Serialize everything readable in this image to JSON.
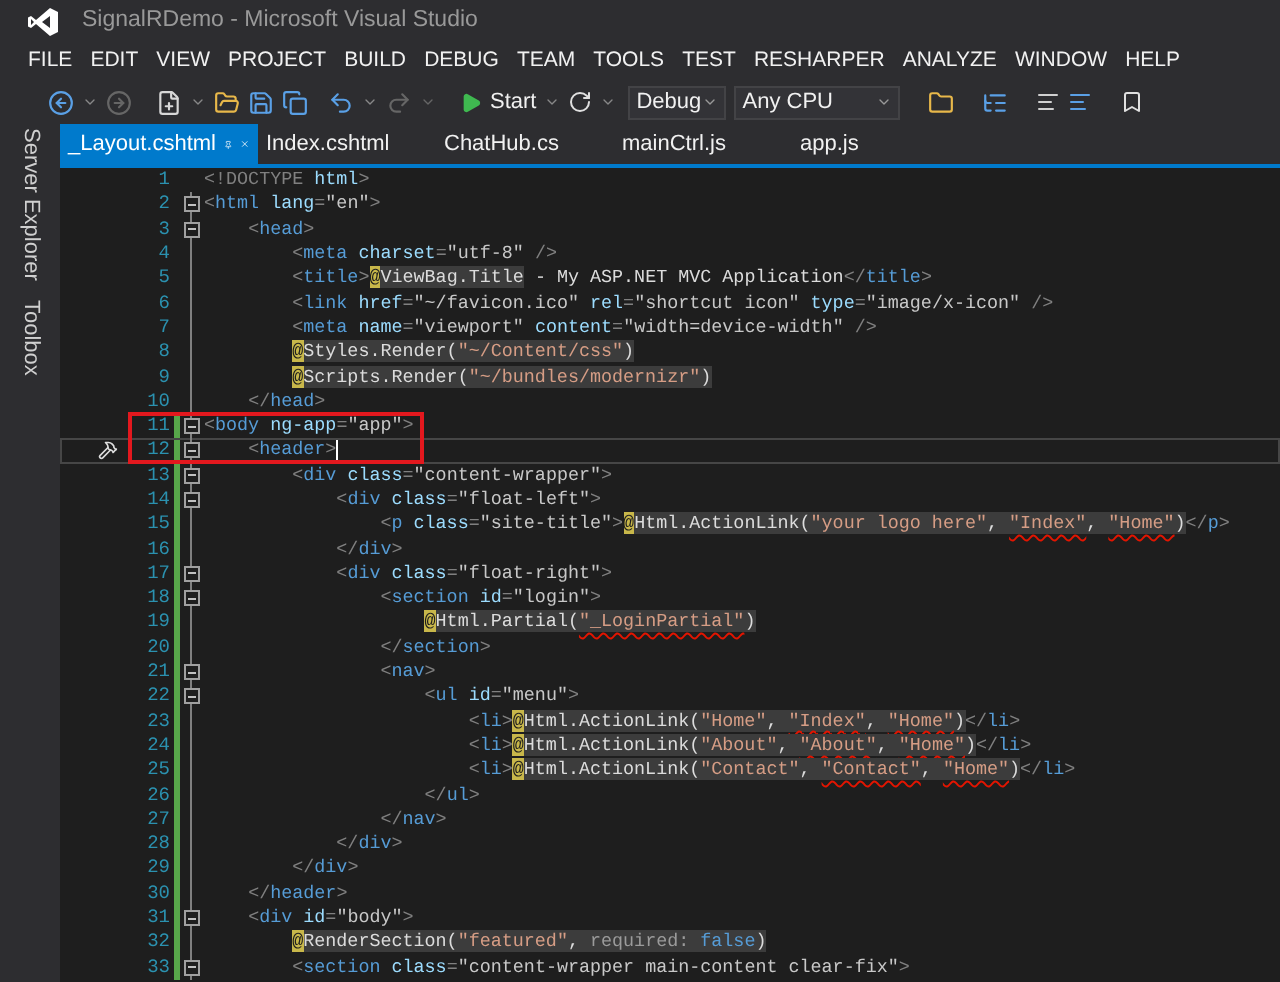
{
  "window": {
    "title": "SignalRDemo - Microsoft Visual Studio"
  },
  "menu": [
    "FILE",
    "EDIT",
    "VIEW",
    "PROJECT",
    "BUILD",
    "DEBUG",
    "TEAM",
    "TOOLS",
    "TEST",
    "RESHARPER",
    "ANALYZE",
    "WINDOW",
    "HELP"
  ],
  "toolbar": {
    "start": "Start",
    "configuration": "Debug",
    "platform": "Any CPU"
  },
  "side_tabs": [
    "Server Explorer",
    "Toolbox"
  ],
  "tabs": [
    {
      "label": "_Layout.cshtml",
      "selected": true
    },
    {
      "label": "Index.cshtml",
      "selected": false
    },
    {
      "label": "ChatHub.cs",
      "selected": false
    },
    {
      "label": "mainCtrl.js",
      "selected": false
    },
    {
      "label": "app.js",
      "selected": false
    }
  ],
  "editor": {
    "lines": [
      {
        "number": "1",
        "foldable": false,
        "changed": false,
        "current": false,
        "segments": [
          {
            "kind": "punct",
            "text": "<!DOCTYPE"
          },
          {
            "kind": "attr",
            "text": " html"
          },
          {
            "kind": "punct",
            "text": ">"
          }
        ]
      },
      {
        "number": "2",
        "foldable": true,
        "changed": false,
        "current": false,
        "segments": [
          {
            "kind": "punct",
            "text": "<"
          },
          {
            "kind": "tag",
            "text": "html"
          },
          {
            "kind": "attr",
            "text": " lang"
          },
          {
            "kind": "punct",
            "text": "="
          },
          {
            "kind": "value",
            "text": "\"en\""
          },
          {
            "kind": "punct",
            "text": ">"
          }
        ]
      },
      {
        "number": "3",
        "foldable": true,
        "changed": false,
        "current": false,
        "segments": [
          {
            "kind": "punct",
            "text": "    <"
          },
          {
            "kind": "tag",
            "text": "head"
          },
          {
            "kind": "punct",
            "text": ">"
          }
        ]
      },
      {
        "number": "4",
        "foldable": false,
        "changed": false,
        "current": false,
        "segments": [
          {
            "kind": "punct",
            "text": "        <"
          },
          {
            "kind": "tag",
            "text": "meta"
          },
          {
            "kind": "attr",
            "text": " charset"
          },
          {
            "kind": "punct",
            "text": "="
          },
          {
            "kind": "value",
            "text": "\"utf-8\""
          },
          {
            "kind": "punct",
            "text": " />"
          }
        ]
      },
      {
        "number": "5",
        "foldable": false,
        "changed": false,
        "current": false,
        "segments": [
          {
            "kind": "punct",
            "text": "        <"
          },
          {
            "kind": "tag",
            "text": "title"
          },
          {
            "kind": "punct",
            "text": ">"
          },
          {
            "kind": "at",
            "text": "@"
          },
          {
            "kind": "code",
            "text": "ViewBag.Title"
          },
          {
            "kind": "text",
            "text": " - My ASP.NET MVC Application"
          },
          {
            "kind": "punct",
            "text": "</"
          },
          {
            "kind": "tag",
            "text": "title"
          },
          {
            "kind": "punct",
            "text": ">"
          }
        ]
      },
      {
        "number": "6",
        "foldable": false,
        "changed": false,
        "current": false,
        "segments": [
          {
            "kind": "punct",
            "text": "        <"
          },
          {
            "kind": "tag",
            "text": "link"
          },
          {
            "kind": "attr",
            "text": " href"
          },
          {
            "kind": "punct",
            "text": "="
          },
          {
            "kind": "value",
            "text": "\"~/favicon.ico\""
          },
          {
            "kind": "attr",
            "text": " rel"
          },
          {
            "kind": "punct",
            "text": "="
          },
          {
            "kind": "value",
            "text": "\"shortcut icon\""
          },
          {
            "kind": "attr",
            "text": " type"
          },
          {
            "kind": "punct",
            "text": "="
          },
          {
            "kind": "value",
            "text": "\"image/x-icon\""
          },
          {
            "kind": "punct",
            "text": " />"
          }
        ]
      },
      {
        "number": "7",
        "foldable": false,
        "changed": false,
        "current": false,
        "segments": [
          {
            "kind": "punct",
            "text": "        <"
          },
          {
            "kind": "tag",
            "text": "meta"
          },
          {
            "kind": "attr",
            "text": " name"
          },
          {
            "kind": "punct",
            "text": "="
          },
          {
            "kind": "value",
            "text": "\"viewport\""
          },
          {
            "kind": "attr",
            "text": " content"
          },
          {
            "kind": "punct",
            "text": "="
          },
          {
            "kind": "value",
            "text": "\"width=device-width\""
          },
          {
            "kind": "punct",
            "text": " />"
          }
        ]
      },
      {
        "number": "8",
        "foldable": false,
        "changed": false,
        "current": false,
        "segments": [
          {
            "kind": "at",
            "text": "        @"
          },
          {
            "kind": "code",
            "text": "Styles.Render("
          },
          {
            "kind": "string",
            "text": "\"~/Content/css\""
          },
          {
            "kind": "code",
            "text": ")"
          }
        ]
      },
      {
        "number": "9",
        "foldable": false,
        "changed": false,
        "current": false,
        "segments": [
          {
            "kind": "at",
            "text": "        @"
          },
          {
            "kind": "code",
            "text": "Scripts.Render("
          },
          {
            "kind": "string",
            "text": "\"~/bundles/modernizr\""
          },
          {
            "kind": "code",
            "text": ")"
          }
        ]
      },
      {
        "number": "10",
        "foldable": false,
        "changed": false,
        "current": false,
        "segments": [
          {
            "kind": "punct",
            "text": "    </"
          },
          {
            "kind": "tag",
            "text": "head"
          },
          {
            "kind": "punct",
            "text": ">"
          }
        ]
      },
      {
        "number": "11",
        "foldable": true,
        "changed": true,
        "current": false,
        "segments": [
          {
            "kind": "punct",
            "text": "<"
          },
          {
            "kind": "tag",
            "text": "body"
          },
          {
            "kind": "attr",
            "text": " ng-app"
          },
          {
            "kind": "punct",
            "text": "="
          },
          {
            "kind": "value",
            "text": "\"app\""
          },
          {
            "kind": "punct",
            "text": ">"
          }
        ]
      },
      {
        "number": "12",
        "foldable": true,
        "changed": true,
        "current": true,
        "segments": [
          {
            "kind": "punct",
            "text": "    <"
          },
          {
            "kind": "tag",
            "text": "header"
          },
          {
            "kind": "punct",
            "text": ">"
          }
        ]
      },
      {
        "number": "13",
        "foldable": true,
        "changed": true,
        "current": false,
        "segments": [
          {
            "kind": "punct",
            "text": "        <"
          },
          {
            "kind": "tag",
            "text": "div"
          },
          {
            "kind": "attr",
            "text": " class"
          },
          {
            "kind": "punct",
            "text": "="
          },
          {
            "kind": "value",
            "text": "\"content-wrapper\""
          },
          {
            "kind": "punct",
            "text": ">"
          }
        ]
      },
      {
        "number": "14",
        "foldable": true,
        "changed": true,
        "current": false,
        "segments": [
          {
            "kind": "punct",
            "text": "            <"
          },
          {
            "kind": "tag",
            "text": "div"
          },
          {
            "kind": "attr",
            "text": " class"
          },
          {
            "kind": "punct",
            "text": "="
          },
          {
            "kind": "value",
            "text": "\"float-left\""
          },
          {
            "kind": "punct",
            "text": ">"
          }
        ]
      },
      {
        "number": "15",
        "foldable": false,
        "changed": true,
        "current": false,
        "segments": [
          {
            "kind": "punct",
            "text": "                <"
          },
          {
            "kind": "tag",
            "text": "p"
          },
          {
            "kind": "attr",
            "text": " class"
          },
          {
            "kind": "punct",
            "text": "="
          },
          {
            "kind": "value",
            "text": "\"site-title\""
          },
          {
            "kind": "punct",
            "text": ">"
          },
          {
            "kind": "at",
            "text": "@"
          },
          {
            "kind": "code",
            "text": "Html.ActionLink("
          },
          {
            "kind": "string",
            "text": "\"your logo here\""
          },
          {
            "kind": "code",
            "text": ", "
          },
          {
            "kind": "flagged",
            "text": "\"Index\""
          },
          {
            "kind": "code",
            "text": ", "
          },
          {
            "kind": "flagged",
            "text": "\"Home\""
          },
          {
            "kind": "code",
            "text": ")"
          },
          {
            "kind": "punct",
            "text": "</"
          },
          {
            "kind": "tag",
            "text": "p"
          },
          {
            "kind": "punct",
            "text": ">"
          }
        ]
      },
      {
        "number": "16",
        "foldable": false,
        "changed": true,
        "current": false,
        "segments": [
          {
            "kind": "punct",
            "text": "            </"
          },
          {
            "kind": "tag",
            "text": "div"
          },
          {
            "kind": "punct",
            "text": ">"
          }
        ]
      },
      {
        "number": "17",
        "foldable": true,
        "changed": true,
        "current": false,
        "segments": [
          {
            "kind": "punct",
            "text": "            <"
          },
          {
            "kind": "tag",
            "text": "div"
          },
          {
            "kind": "attr",
            "text": " class"
          },
          {
            "kind": "punct",
            "text": "="
          },
          {
            "kind": "value",
            "text": "\"float-right\""
          },
          {
            "kind": "punct",
            "text": ">"
          }
        ]
      },
      {
        "number": "18",
        "foldable": true,
        "changed": true,
        "current": false,
        "segments": [
          {
            "kind": "punct",
            "text": "                <"
          },
          {
            "kind": "tag",
            "text": "section"
          },
          {
            "kind": "attr",
            "text": " id"
          },
          {
            "kind": "punct",
            "text": "="
          },
          {
            "kind": "value",
            "text": "\"login\""
          },
          {
            "kind": "punct",
            "text": ">"
          }
        ]
      },
      {
        "number": "19",
        "foldable": false,
        "changed": true,
        "current": false,
        "segments": [
          {
            "kind": "at",
            "text": "                    @"
          },
          {
            "kind": "code",
            "text": "Html.Partial("
          },
          {
            "kind": "flagged",
            "text": "\"_LoginPartial\""
          },
          {
            "kind": "code",
            "text": ")"
          }
        ]
      },
      {
        "number": "20",
        "foldable": false,
        "changed": true,
        "current": false,
        "segments": [
          {
            "kind": "punct",
            "text": "                </"
          },
          {
            "kind": "tag",
            "text": "section"
          },
          {
            "kind": "punct",
            "text": ">"
          }
        ]
      },
      {
        "number": "21",
        "foldable": true,
        "changed": true,
        "current": false,
        "segments": [
          {
            "kind": "punct",
            "text": "                <"
          },
          {
            "kind": "tag",
            "text": "nav"
          },
          {
            "kind": "punct",
            "text": ">"
          }
        ]
      },
      {
        "number": "22",
        "foldable": true,
        "changed": true,
        "current": false,
        "segments": [
          {
            "kind": "punct",
            "text": "                    <"
          },
          {
            "kind": "tag",
            "text": "ul"
          },
          {
            "kind": "attr",
            "text": " id"
          },
          {
            "kind": "punct",
            "text": "="
          },
          {
            "kind": "value",
            "text": "\"menu\""
          },
          {
            "kind": "punct",
            "text": ">"
          }
        ]
      },
      {
        "number": "23",
        "foldable": false,
        "changed": true,
        "current": false,
        "segments": [
          {
            "kind": "punct",
            "text": "                        <"
          },
          {
            "kind": "tag",
            "text": "li"
          },
          {
            "kind": "punct",
            "text": ">"
          },
          {
            "kind": "at",
            "text": "@"
          },
          {
            "kind": "code",
            "text": "Html.ActionLink("
          },
          {
            "kind": "string",
            "text": "\"Home\""
          },
          {
            "kind": "code",
            "text": ", "
          },
          {
            "kind": "flagged",
            "text": "\"Index\""
          },
          {
            "kind": "code",
            "text": ", "
          },
          {
            "kind": "flagged",
            "text": "\"Home\""
          },
          {
            "kind": "code",
            "text": ")"
          },
          {
            "kind": "punct",
            "text": "</"
          },
          {
            "kind": "tag",
            "text": "li"
          },
          {
            "kind": "punct",
            "text": ">"
          }
        ]
      },
      {
        "number": "24",
        "foldable": false,
        "changed": true,
        "current": false,
        "segments": [
          {
            "kind": "punct",
            "text": "                        <"
          },
          {
            "kind": "tag",
            "text": "li"
          },
          {
            "kind": "punct",
            "text": ">"
          },
          {
            "kind": "at",
            "text": "@"
          },
          {
            "kind": "code",
            "text": "Html.ActionLink("
          },
          {
            "kind": "string",
            "text": "\"About\""
          },
          {
            "kind": "code",
            "text": ", "
          },
          {
            "kind": "flagged",
            "text": "\"About\""
          },
          {
            "kind": "code",
            "text": ", "
          },
          {
            "kind": "flagged",
            "text": "\"Home\""
          },
          {
            "kind": "code",
            "text": ")"
          },
          {
            "kind": "punct",
            "text": "</"
          },
          {
            "kind": "tag",
            "text": "li"
          },
          {
            "kind": "punct",
            "text": ">"
          }
        ]
      },
      {
        "number": "25",
        "foldable": false,
        "changed": true,
        "current": false,
        "segments": [
          {
            "kind": "punct",
            "text": "                        <"
          },
          {
            "kind": "tag",
            "text": "li"
          },
          {
            "kind": "punct",
            "text": ">"
          },
          {
            "kind": "at",
            "text": "@"
          },
          {
            "kind": "code",
            "text": "Html.ActionLink("
          },
          {
            "kind": "string",
            "text": "\"Contact\""
          },
          {
            "kind": "code",
            "text": ", "
          },
          {
            "kind": "flagged",
            "text": "\"Contact\""
          },
          {
            "kind": "code",
            "text": ", "
          },
          {
            "kind": "flagged",
            "text": "\"Home\""
          },
          {
            "kind": "code",
            "text": ")"
          },
          {
            "kind": "punct",
            "text": "</"
          },
          {
            "kind": "tag",
            "text": "li"
          },
          {
            "kind": "punct",
            "text": ">"
          }
        ]
      },
      {
        "number": "26",
        "foldable": false,
        "changed": true,
        "current": false,
        "segments": [
          {
            "kind": "punct",
            "text": "                    </"
          },
          {
            "kind": "tag",
            "text": "ul"
          },
          {
            "kind": "punct",
            "text": ">"
          }
        ]
      },
      {
        "number": "27",
        "foldable": false,
        "changed": true,
        "current": false,
        "segments": [
          {
            "kind": "punct",
            "text": "                </"
          },
          {
            "kind": "tag",
            "text": "nav"
          },
          {
            "kind": "punct",
            "text": ">"
          }
        ]
      },
      {
        "number": "28",
        "foldable": false,
        "changed": true,
        "current": false,
        "segments": [
          {
            "kind": "punct",
            "text": "            </"
          },
          {
            "kind": "tag",
            "text": "div"
          },
          {
            "kind": "punct",
            "text": ">"
          }
        ]
      },
      {
        "number": "29",
        "foldable": false,
        "changed": true,
        "current": false,
        "segments": [
          {
            "kind": "punct",
            "text": "        </"
          },
          {
            "kind": "tag",
            "text": "div"
          },
          {
            "kind": "punct",
            "text": ">"
          }
        ]
      },
      {
        "number": "30",
        "foldable": false,
        "changed": true,
        "current": false,
        "segments": [
          {
            "kind": "punct",
            "text": "    </"
          },
          {
            "kind": "tag",
            "text": "header"
          },
          {
            "kind": "punct",
            "text": ">"
          }
        ]
      },
      {
        "number": "31",
        "foldable": true,
        "changed": true,
        "current": false,
        "segments": [
          {
            "kind": "punct",
            "text": "    <"
          },
          {
            "kind": "tag",
            "text": "div"
          },
          {
            "kind": "attr",
            "text": " id"
          },
          {
            "kind": "punct",
            "text": "="
          },
          {
            "kind": "value",
            "text": "\"body\""
          },
          {
            "kind": "punct",
            "text": ">"
          }
        ]
      },
      {
        "number": "32",
        "foldable": false,
        "changed": true,
        "current": false,
        "segments": [
          {
            "kind": "at",
            "text": "        @"
          },
          {
            "kind": "code",
            "text": "RenderSection("
          },
          {
            "kind": "string",
            "text": "\"featured\""
          },
          {
            "kind": "code",
            "text": ", "
          },
          {
            "kind": "param",
            "text": "required: "
          },
          {
            "kind": "keyword",
            "text": "false"
          },
          {
            "kind": "code",
            "text": ")"
          }
        ]
      },
      {
        "number": "33",
        "foldable": true,
        "changed": true,
        "current": false,
        "segments": [
          {
            "kind": "punct",
            "text": "        <"
          },
          {
            "kind": "tag",
            "text": "section"
          },
          {
            "kind": "attr",
            "text": " class"
          },
          {
            "kind": "punct",
            "text": "="
          },
          {
            "kind": "value",
            "text": "\"content-wrapper main-content clear-fix\""
          },
          {
            "kind": "punct",
            "text": ">"
          }
        ]
      }
    ]
  }
}
